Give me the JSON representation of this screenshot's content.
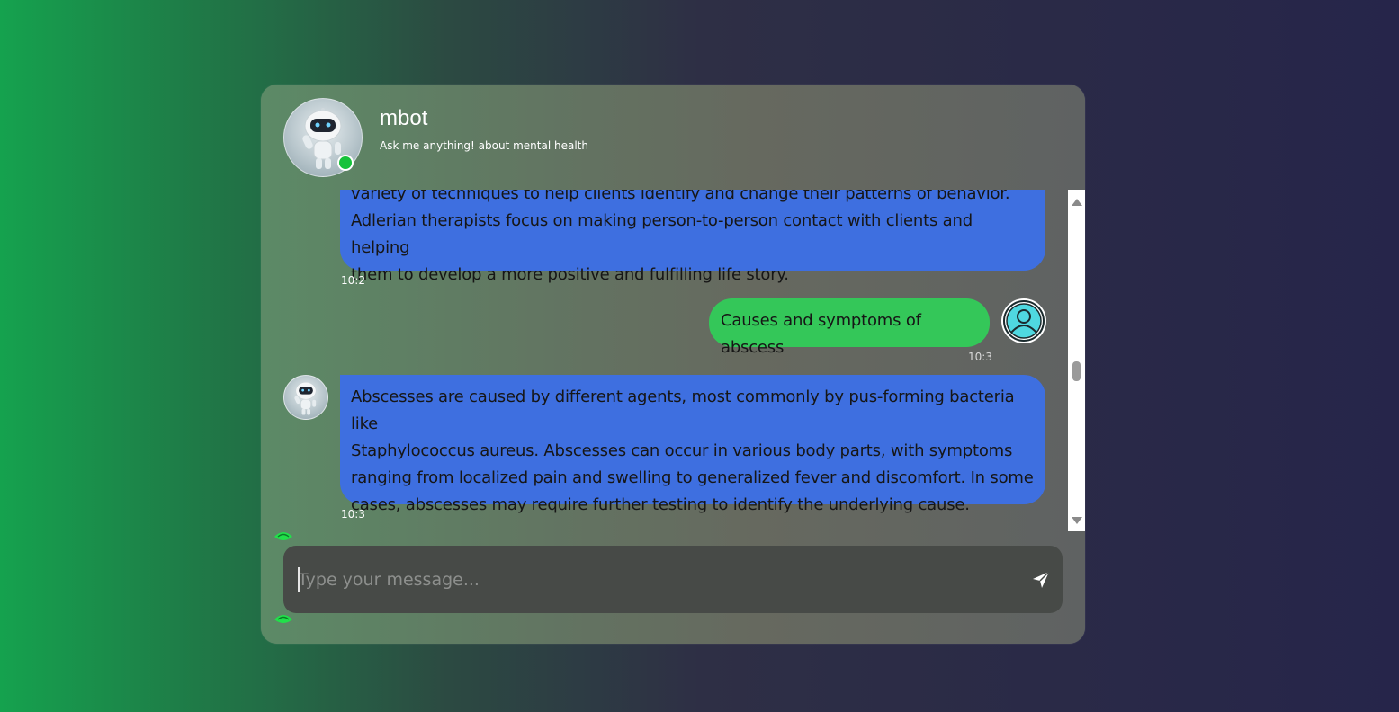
{
  "header": {
    "bot_name": "mbot",
    "subtitle": "Ask me anything! about mental health",
    "status": "online"
  },
  "messages": [
    {
      "role": "bot",
      "lines": [
        "variety of techniques to help clients identify and change their patterns of behavior.",
        "Adlerian therapists focus on making person-to-person contact with clients and helping",
        "them to develop a more positive and fulfilling life story."
      ],
      "time": "10:2"
    },
    {
      "role": "user",
      "text": "Causes and symptoms of abscess",
      "time": "10:3"
    },
    {
      "role": "bot",
      "lines": [
        "Abscesses are caused by different agents, most commonly by pus-forming bacteria like",
        "Staphylococcus aureus. Abscesses can occur in various body parts, with symptoms",
        "ranging from localized pain and swelling to generalized fever and discomfort. In some",
        "cases, abscesses may require further testing to identify the underlying cause."
      ],
      "time": "10:3"
    }
  ],
  "input": {
    "placeholder": "Type your message...",
    "value": ""
  },
  "icons": {
    "send": "send-icon",
    "avatar_user": "user-icon",
    "avatar_bot": "robot-icon"
  },
  "colors": {
    "bot_bubble": "#3e6fe0",
    "user_bubble": "#34c759",
    "online": "#16c23a"
  }
}
